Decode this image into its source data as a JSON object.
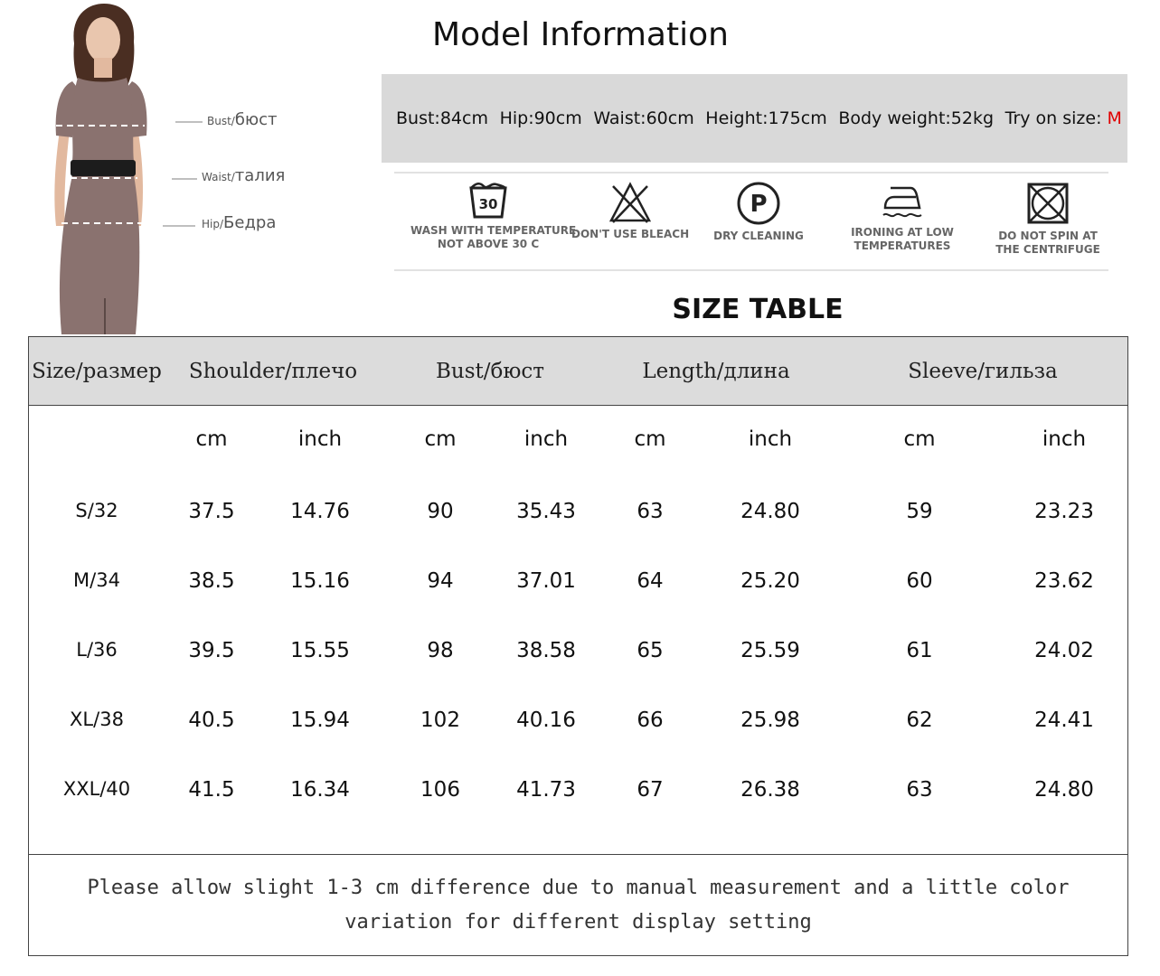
{
  "model_labels": [
    {
      "en": "Bust/",
      "ru": "бюст"
    },
    {
      "en": "Waist/",
      "ru": "талия"
    },
    {
      "en": "Hip/",
      "ru": "Бедра"
    }
  ],
  "model_info": {
    "title": "Model Information",
    "bust": "Bust:84cm",
    "hip": "Hip:90cm",
    "waist": "Waist:60cm",
    "height": "Height:175cm",
    "weight": "Body weight:52kg",
    "try_label": "Try on size:",
    "try_size": "M"
  },
  "care_icons": [
    {
      "icon": "wash-30-icon",
      "line1": "WASH WITH TEMPERATURE",
      "line2": "NOT ABOVE 30 C",
      "temp": "30"
    },
    {
      "icon": "no-bleach-icon",
      "line1": "DON'T USE BLEACH",
      "line2": ""
    },
    {
      "icon": "dry-clean-icon",
      "line1": "DRY CLEANING",
      "line2": "",
      "letter": "P"
    },
    {
      "icon": "iron-low-icon",
      "line1": "IRONING AT LOW",
      "line2": "TEMPERATURES"
    },
    {
      "icon": "no-spin-icon",
      "line1": "DO NOT SPIN AT",
      "line2": "THE CENTRIFUGE"
    }
  ],
  "size_table": {
    "title": "SIZE TABLE",
    "headers": [
      "Size/размер",
      "Shoulder/плечо",
      "Bust/бюст",
      "Length/длина",
      "Sleeve/гильза"
    ],
    "units": [
      "cm",
      "inch",
      "cm",
      "inch",
      "cm",
      "inch",
      "cm",
      "inch"
    ],
    "rows": [
      [
        "S/32",
        "37.5",
        "14.76",
        "90",
        "35.43",
        "63",
        "24.80",
        "59",
        "23.23"
      ],
      [
        "M/34",
        "38.5",
        "15.16",
        "94",
        "37.01",
        "64",
        "25.20",
        "60",
        "23.62"
      ],
      [
        "L/36",
        "39.5",
        "15.55",
        "98",
        "38.58",
        "65",
        "25.59",
        "61",
        "24.02"
      ],
      [
        "XL/38",
        "40.5",
        "15.94",
        "102",
        "40.16",
        "66",
        "25.98",
        "62",
        "24.41"
      ],
      [
        "XXL/40",
        "41.5",
        "16.34",
        "106",
        "41.73",
        "67",
        "26.38",
        "63",
        "24.80"
      ]
    ],
    "note": "Please allow slight 1-3 cm difference due to manual measurement and a little color variation for different display setting"
  },
  "colors": {
    "dress": "#8a726f",
    "header_bg": "#dcdcdc",
    "info_bg": "#d9d9d9",
    "accent": "#e00000"
  }
}
